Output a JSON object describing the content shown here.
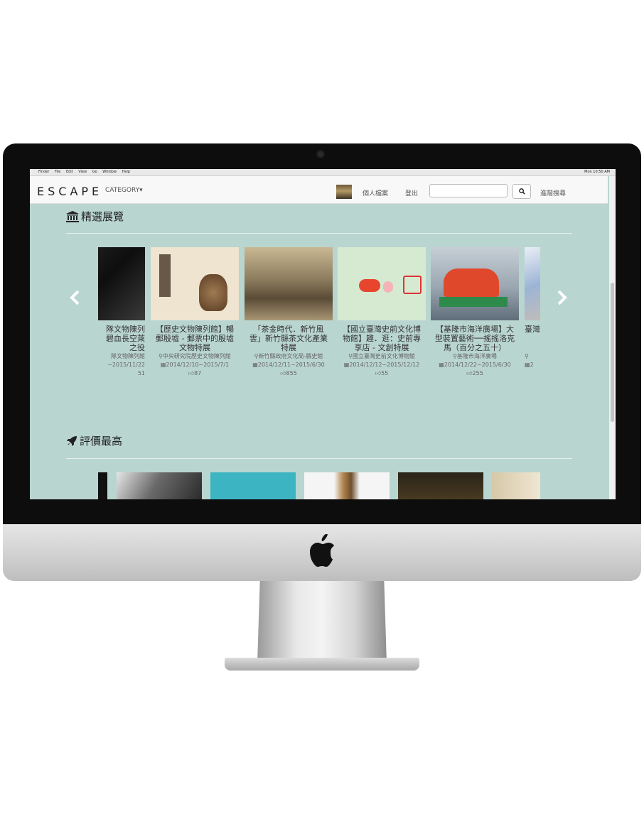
{
  "menubar": {
    "items": [
      "Finder",
      "File",
      "Edit",
      "View",
      "Go",
      "Window",
      "Help"
    ],
    "clock": "Mon 10:50 AM"
  },
  "navbar": {
    "logo": "ESCAPE",
    "category": "CATEGORY▾",
    "profile": "個人檔案",
    "logout": "登出",
    "search_value": "",
    "advanced": "進階搜尋"
  },
  "featured": {
    "title": "精選展覽",
    "cards": [
      {
        "title": "隊文物陳列\n碧血長空萊\n之役",
        "place": "隊文物陳列館",
        "date": "~2015/11/22",
        "likes": "51",
        "color": "#1b1b1b"
      },
      {
        "title": "【歷史文物陳列館】暢\n郵殷墟 - 郵票中的殷墟\n文物特展",
        "place": "中央研究院歷史文物陳列館",
        "date": "2014/12/10~2015/7/1",
        "likes": "87",
        "color": "#efe4d0"
      },
      {
        "title": "「茶金時代．新竹風\n雲」新竹縣茶文化產業\n特展",
        "place": "新竹縣政府文化局-縣史館",
        "date": "2014/12/11~2015/6/30",
        "likes": "855",
        "color": "#8b7b5d"
      },
      {
        "title": "【國立臺灣史前文化博\n物館】趣．逛：史前專\n享店 - 文創特展",
        "place": "國立臺灣史前文化博物館",
        "date": "2014/12/12~2015/12/12",
        "likes": "55",
        "color": "#d6ead2"
      },
      {
        "title": "【基隆市海洋廣場】大\n型裝置藝術──搖搖洛克\n馬（百分之五十）",
        "place": "基隆市海洋廣場",
        "date": "2014/12/22~2015/6/30",
        "likes": "255",
        "color": "#8a9aa8"
      },
      {
        "title": "臺灣",
        "place": "",
        "date": "2",
        "likes": "",
        "color": "#c8d4e8"
      }
    ]
  },
  "rated": {
    "title": "評價最高"
  }
}
